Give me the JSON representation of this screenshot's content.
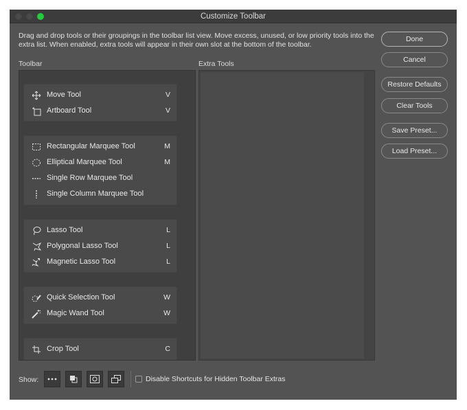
{
  "window": {
    "title": "Customize Toolbar"
  },
  "description": "Drag and drop tools or their groupings in the toolbar list view. Move excess, unused, or low priority tools into the extra list. When enabled, extra tools will appear in their own slot at the bottom of the toolbar.",
  "columns": {
    "toolbar_label": "Toolbar",
    "extra_label": "Extra Tools"
  },
  "tool_groups": [
    [
      {
        "name": "Move Tool",
        "key": "V",
        "icon": "move-icon"
      },
      {
        "name": "Artboard Tool",
        "key": "V",
        "icon": "artboard-icon"
      }
    ],
    [
      {
        "name": "Rectangular Marquee Tool",
        "key": "M",
        "icon": "rect-marquee-icon"
      },
      {
        "name": "Elliptical Marquee Tool",
        "key": "M",
        "icon": "ellipse-marquee-icon"
      },
      {
        "name": "Single Row Marquee Tool",
        "key": "",
        "icon": "row-marquee-icon"
      },
      {
        "name": "Single Column Marquee Tool",
        "key": "",
        "icon": "column-marquee-icon"
      }
    ],
    [
      {
        "name": "Lasso Tool",
        "key": "L",
        "icon": "lasso-icon"
      },
      {
        "name": "Polygonal Lasso Tool",
        "key": "L",
        "icon": "polygonal-lasso-icon"
      },
      {
        "name": "Magnetic Lasso Tool",
        "key": "L",
        "icon": "magnetic-lasso-icon"
      }
    ],
    [
      {
        "name": "Quick Selection Tool",
        "key": "W",
        "icon": "quick-selection-icon"
      },
      {
        "name": "Magic Wand Tool",
        "key": "W",
        "icon": "magic-wand-icon"
      }
    ],
    [
      {
        "name": "Crop Tool",
        "key": "C",
        "icon": "crop-icon"
      }
    ]
  ],
  "buttons": {
    "done": "Done",
    "cancel": "Cancel",
    "restore_defaults": "Restore Defaults",
    "clear_tools": "Clear Tools",
    "save_preset": "Save Preset...",
    "load_preset": "Load Preset..."
  },
  "bottom": {
    "show_label": "Show:",
    "show_icons": [
      "more-icon",
      "fill-swatch-icon",
      "quick-mask-icon",
      "screen-mode-icon"
    ],
    "disable_shortcuts_label": "Disable Shortcuts for Hidden Toolbar Extras",
    "disable_shortcuts_checked": false
  }
}
